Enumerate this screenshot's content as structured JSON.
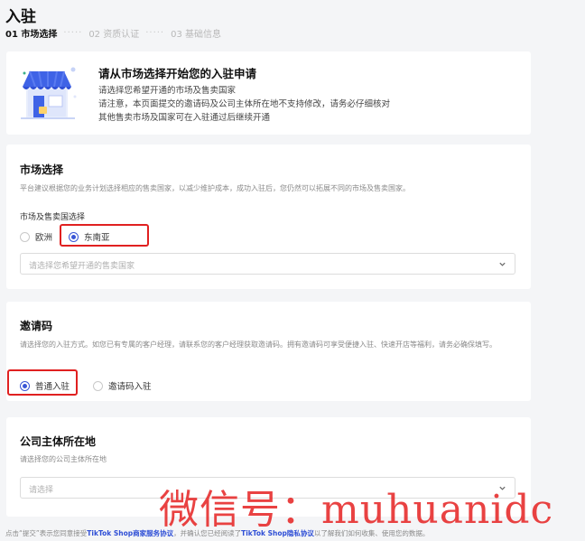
{
  "page": {
    "title": "入驻"
  },
  "steps": [
    {
      "label": "01 市场选择",
      "active": true
    },
    {
      "label": "02 资质认证",
      "active": false
    },
    {
      "label": "03 基础信息",
      "active": false
    }
  ],
  "step_separator": "·····",
  "intro": {
    "icon": "store-illustration",
    "title": "请从市场选择开始您的入驻申请",
    "lines": [
      "请选择您希望开通的市场及售卖国家",
      "请注意，本页面提交的邀请码及公司主体所在地不支持修改，请务必仔细核对",
      "其他售卖市场及国家可在入驻通过后继续开通"
    ]
  },
  "market": {
    "title": "市场选择",
    "description": "平台建议根据您的业务计划选择相应的售卖国家，以减少维护成本，成功入驻后，您仍然可以拓展不同的市场及售卖国家。",
    "field_label": "市场及售卖国选择",
    "options": [
      {
        "label": "欧洲",
        "checked": false
      },
      {
        "label": "东南亚",
        "checked": true
      }
    ],
    "select_placeholder": "请选择您希望开通的售卖国家"
  },
  "invite": {
    "title": "邀请码",
    "description": "请选择您的入驻方式。如您已有专属的客户经理，请联系您的客户经理获取邀请码。拥有邀请码可享受便捷入驻、快速开店等福利，请务必确保填写。",
    "options": [
      {
        "label": "普通入驻",
        "checked": true
      },
      {
        "label": "邀请码入驻",
        "checked": false
      }
    ]
  },
  "company": {
    "title": "公司主体所在地",
    "description": "请选择您的公司主体所在地",
    "select_placeholder": "请选择"
  },
  "footer": {
    "prefix": "点击“提交”表示您同意接受",
    "link1": "TikTok Shop商家服务协议",
    "middle": "，并确认您已经阅读了",
    "link2": "TikTok Shop隐私协议",
    "suffix": "以了解我们如何收集、使用您的数据。"
  },
  "watermark": "微信号：muhuanidc",
  "colors": {
    "accent": "#3a56d6",
    "highlight": "#e02020",
    "watermark": "#e62828"
  }
}
